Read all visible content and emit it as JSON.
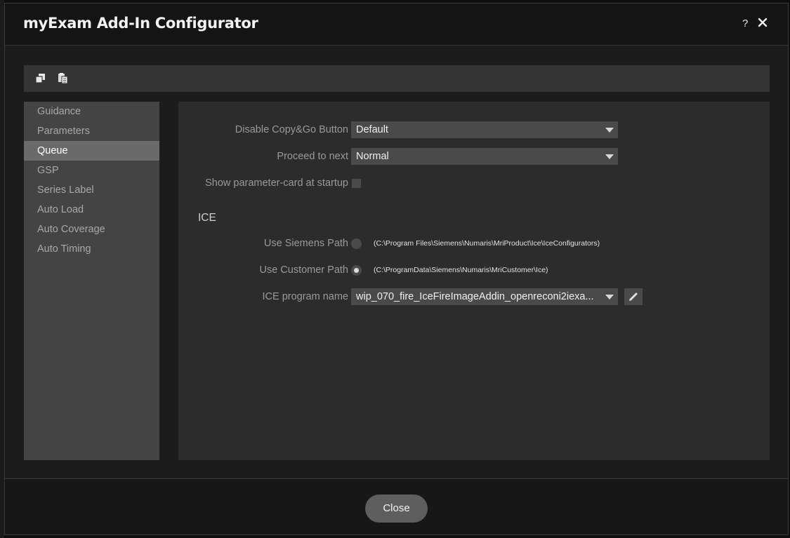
{
  "window": {
    "title": "myExam Add-In Configurator",
    "help_label": "?"
  },
  "toolbar": {
    "icons": [
      "restore-icon",
      "paste-icon"
    ]
  },
  "sidebar": {
    "items": [
      {
        "label": "Guidance",
        "active": false
      },
      {
        "label": "Parameters",
        "active": false
      },
      {
        "label": "Queue",
        "active": true
      },
      {
        "label": "GSP",
        "active": false
      },
      {
        "label": "Series Label",
        "active": false
      },
      {
        "label": "Auto Load",
        "active": false
      },
      {
        "label": "Auto Coverage",
        "active": false
      },
      {
        "label": "Auto Timing",
        "active": false
      }
    ]
  },
  "settings": {
    "disable_copy_go": {
      "label": "Disable Copy&Go Button",
      "value": "Default"
    },
    "proceed_to_next": {
      "label": "Proceed to next",
      "value": "Normal"
    },
    "show_param_card": {
      "label": "Show parameter-card at startup",
      "checked": false
    }
  },
  "ice": {
    "section_title": "ICE",
    "siemens_path": {
      "label": "Use Siemens Path",
      "path": "(C:\\Program Files\\Siemens\\Numaris\\MriProduct\\Ice\\IceConfigurators)",
      "selected": false
    },
    "customer_path": {
      "label": "Use Customer Path",
      "path": "(C:\\ProgramData\\Siemens\\Numaris\\MriCustomer\\Ice)",
      "selected": true
    },
    "program_name": {
      "label": "ICE program name",
      "value": "wip_070_fire_IceFireImageAddin_openreconi2iexa..."
    }
  },
  "footer": {
    "close_label": "Close"
  },
  "colors": {
    "title_bar": "#141414",
    "panel": "#2c2c2c",
    "sidebar": "#444444",
    "active_item": "#6a6a6a",
    "control": "#4a4a4a"
  }
}
